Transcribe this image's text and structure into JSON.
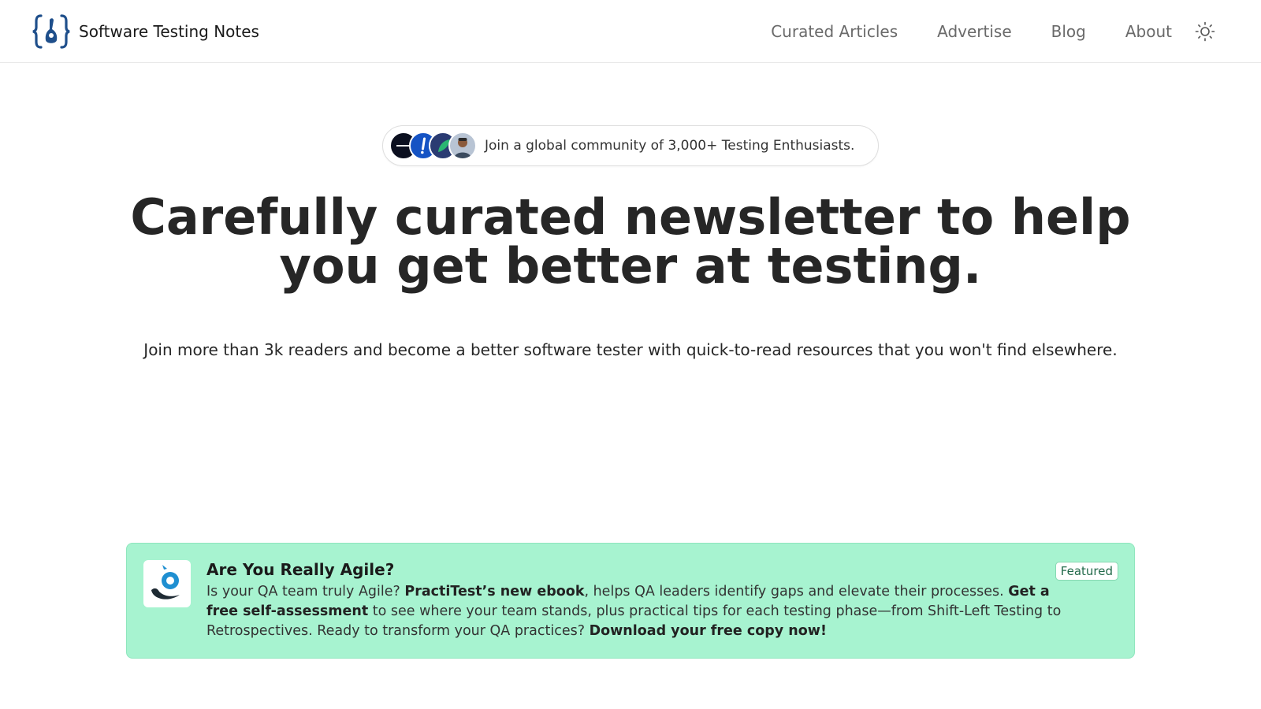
{
  "header": {
    "brand_name": "Software Testing Notes",
    "nav": [
      {
        "label": "Curated Articles"
      },
      {
        "label": "Advertise"
      },
      {
        "label": "Blog"
      },
      {
        "label": "About"
      }
    ],
    "theme_icon": "sun-icon"
  },
  "hero": {
    "community_text": "Join a global community of 3,000+ Testing Enthusiasts.",
    "headline_line1": "Carefully curated newsletter to help",
    "headline_line2": "you get better at testing.",
    "subtitle": "Join more than 3k readers and become a better software tester with quick-to-read resources that you won't find elsewhere."
  },
  "featured": {
    "badge": "Featured",
    "title": "Are You Really Agile?",
    "text_1": "Is your QA team truly Agile? ",
    "bold_1": "PractiTest’s new ebook",
    "text_2": ", helps QA leaders identify gaps and elevate their processes. ",
    "bold_2": "Get a free self-assessment",
    "text_3": " to see where your team stands, plus practical tips for each testing phase—from Shift-Left Testing to Retrospectives. Ready to transform your QA practices? ",
    "bold_3": "Download your free copy now!"
  },
  "colors": {
    "accent_blue": "#1f4f8b",
    "card_background": "#a7f3d0",
    "text_dark": "#262626",
    "nav_text": "#6a6a6a"
  }
}
